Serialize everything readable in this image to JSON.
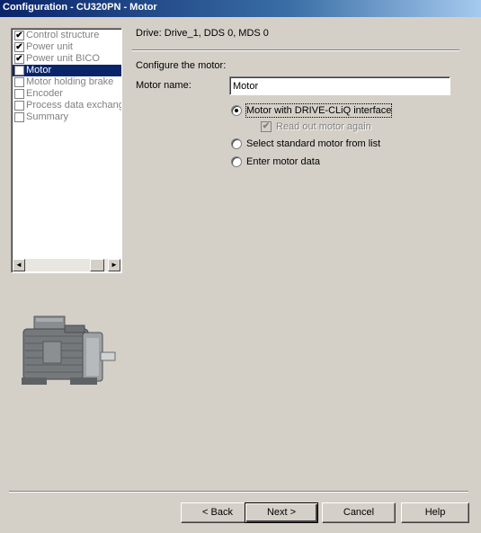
{
  "window": {
    "title": "Configuration - CU320PN - Motor"
  },
  "sidebar": {
    "items": [
      {
        "label": "Control structure",
        "checked": true
      },
      {
        "label": "Power unit",
        "checked": true
      },
      {
        "label": "Power unit BICO",
        "checked": true
      },
      {
        "label": "Motor",
        "checked": false,
        "selected": true
      },
      {
        "label": "Motor holding brake",
        "checked": false
      },
      {
        "label": "Encoder",
        "checked": false
      },
      {
        "label": "Process data exchange",
        "checked": false
      },
      {
        "label": "Summary",
        "checked": false
      }
    ],
    "check_glyph": "✔"
  },
  "main": {
    "drive_info": "Drive: Drive_1, DDS 0, MDS 0",
    "section_label": "Configure the motor:",
    "motor_name_label": "Motor name:",
    "motor_name_value": "Motor",
    "options": [
      {
        "label": "Motor with DRIVE-CLiQ interface",
        "selected": true
      },
      {
        "label": "Select standard motor from list",
        "selected": false
      },
      {
        "label": "Enter motor data",
        "selected": false
      }
    ],
    "read_out_again_label": "Read out motor again",
    "read_out_again_checked": true,
    "read_out_again_enabled": false
  },
  "buttons": {
    "back": "< Back",
    "next": "Next >",
    "cancel": "Cancel",
    "help": "Help"
  },
  "icons": {
    "scroll_left": "◄",
    "scroll_right": "►",
    "motor_image": "motor-illustration"
  }
}
